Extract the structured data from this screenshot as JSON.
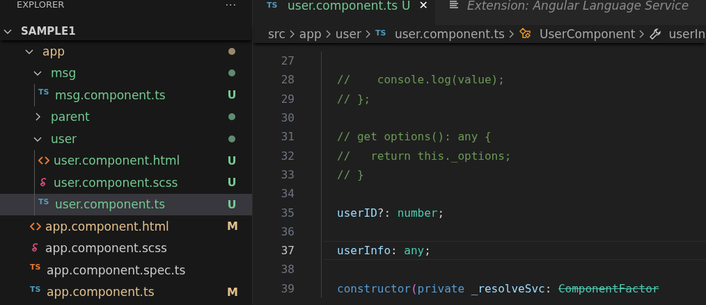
{
  "explorer": {
    "title": "EXPLORER",
    "more": "···",
    "workspace": {
      "label": "SAMPLE1",
      "expanded": true,
      "children": [
        {
          "label": "app",
          "kind": "folder",
          "expanded": true,
          "color": "#e2c08d",
          "has_changes": true,
          "selected": false,
          "children": [
            {
              "label": "msg",
              "kind": "folder",
              "expanded": true,
              "color": "#73c991",
              "has_changes": true,
              "selected": false,
              "children": [
                {
                  "label": "msg.component.ts",
                  "kind": "ts",
                  "icon_text": "TS",
                  "color": "#73c991",
                  "status": "U",
                  "selected": false
                }
              ]
            },
            {
              "label": "parent",
              "kind": "folder",
              "expanded": false,
              "color": "#73c991",
              "has_changes": true,
              "selected": false
            },
            {
              "label": "user",
              "kind": "folder",
              "expanded": true,
              "color": "#73c991",
              "has_changes": true,
              "selected": false,
              "children": [
                {
                  "label": "user.component.html",
                  "kind": "html",
                  "color": "#73c991",
                  "status": "U",
                  "selected": false
                },
                {
                  "label": "user.component.scss",
                  "kind": "scss",
                  "color": "#73c991",
                  "status": "U",
                  "selected": false
                },
                {
                  "label": "user.component.ts",
                  "kind": "ts",
                  "icon_text": "TS",
                  "color": "#73c991",
                  "status": "U",
                  "selected": true
                }
              ]
            },
            {
              "label": "app.component.html",
              "kind": "html",
              "color": "#e2c08d",
              "status": "M",
              "selected": false
            },
            {
              "label": "app.component.scss",
              "kind": "scss",
              "color": "#cccccc",
              "selected": false
            },
            {
              "label": "app.component.spec.ts",
              "kind": "test",
              "icon_text": "TS",
              "color": "#cccccc",
              "selected": false
            },
            {
              "label": "app.component.ts",
              "kind": "ts",
              "icon_text": "TS",
              "color": "#e2c08d",
              "status": "M",
              "selected": false
            }
          ]
        }
      ]
    }
  },
  "tabs": [
    {
      "label": "user.component.ts",
      "kind": "ts",
      "icon_text": "TS",
      "status": "U",
      "close": "✕",
      "selected": true
    },
    {
      "label": "Extension: Angular Language Service",
      "kind": "preview",
      "selected": false
    }
  ],
  "breadcrumb": [
    {
      "kind": "text",
      "label": "src"
    },
    {
      "kind": "text",
      "label": "app"
    },
    {
      "kind": "text",
      "label": "user"
    },
    {
      "kind": "ts",
      "icon_text": "TS",
      "label": "user.component.ts"
    },
    {
      "kind": "class",
      "label": "UserComponent"
    },
    {
      "kind": "property",
      "label": "userIn"
    }
  ],
  "editor": {
    "lines": [
      {
        "number": "27",
        "current": false
      },
      {
        "number": "28",
        "current": false,
        "tokens": [
          {
            "kind": "comment",
            "text": "//    console.log(value);"
          }
        ]
      },
      {
        "number": "29",
        "current": false,
        "tokens": [
          {
            "kind": "comment",
            "text": "// };"
          }
        ]
      },
      {
        "number": "30",
        "current": false
      },
      {
        "number": "31",
        "current": false,
        "tokens": [
          {
            "kind": "comment",
            "text": "// get options(): any {"
          }
        ]
      },
      {
        "number": "32",
        "current": false,
        "tokens": [
          {
            "kind": "comment",
            "text": "//   return this._options;"
          }
        ]
      },
      {
        "number": "33",
        "current": false,
        "tokens": [
          {
            "kind": "comment",
            "text": "// }"
          }
        ]
      },
      {
        "number": "34",
        "current": false
      },
      {
        "number": "35",
        "current": false,
        "tokens": [
          {
            "kind": "property",
            "text": "userID"
          },
          {
            "kind": "plain",
            "text": "?: "
          },
          {
            "kind": "type",
            "text": "number"
          },
          {
            "kind": "plain",
            "text": ";"
          }
        ]
      },
      {
        "number": "36",
        "current": false
      },
      {
        "number": "37",
        "current": true,
        "tokens": [
          {
            "kind": "property",
            "text": "userInfo"
          },
          {
            "kind": "plain",
            "text": ": "
          },
          {
            "kind": "type",
            "text": "any"
          },
          {
            "kind": "plain",
            "text": ";"
          }
        ]
      },
      {
        "number": "38",
        "current": false
      },
      {
        "number": "39",
        "current": false,
        "tokens": [
          {
            "kind": "keyword",
            "text": "constructor"
          },
          {
            "kind": "bracket",
            "text": "("
          },
          {
            "kind": "keyword",
            "text": "private"
          },
          {
            "kind": "property",
            "text": " _resolveSvc"
          },
          {
            "kind": "plain",
            "text": ": "
          },
          {
            "kind": "deprecated",
            "text": "ComponentFactor"
          }
        ]
      }
    ]
  }
}
